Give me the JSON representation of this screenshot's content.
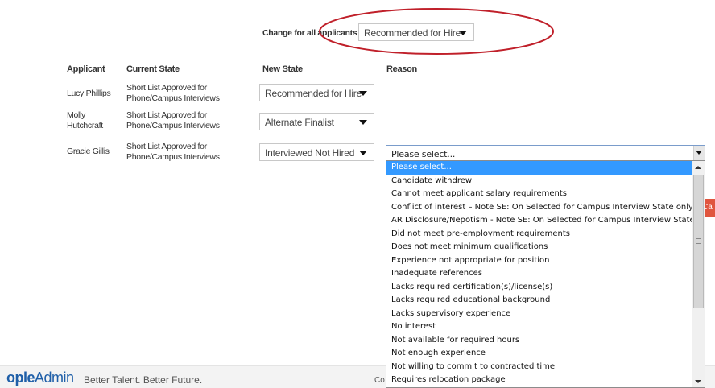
{
  "change_all": {
    "label": "Change for all applicants",
    "value": "Recommended for Hire"
  },
  "table": {
    "headers": [
      "Applicant",
      "Current State",
      "New State",
      "Reason"
    ],
    "rows": [
      {
        "applicant": [
          "Lucy Phillips"
        ],
        "current_state": [
          "Short List Approved for",
          "Phone/Campus Interviews"
        ],
        "new_state": "Recommended for Hire"
      },
      {
        "applicant": [
          "Molly",
          "Hutchcraft"
        ],
        "current_state": [
          "Short List Approved for",
          "Phone/Campus Interviews"
        ],
        "new_state": "Alternate Finalist"
      },
      {
        "applicant": [
          "Gracie Gillis"
        ],
        "current_state": [
          "Short List Approved for",
          "Phone/Campus Interviews"
        ],
        "new_state": "Interviewed Not Hired"
      }
    ]
  },
  "reason": {
    "value": "Please select...",
    "options": [
      "Please select...",
      "Candidate withdrew",
      "Cannot meet applicant salary requirements",
      "Conflict of interest – Note SE: On Selected for Campus Interview State only",
      "AR Disclosure/Nepotism - Note SE: On Selected for Campus Interview State only",
      "Did not meet pre-employment requirements",
      "Does not meet minimum qualifications",
      "Experience not appropriate for position",
      "Inadequate references",
      "Lacks required certification(s)/license(s)",
      "Lacks required educational background",
      "Lacks supervisory experience",
      "No interest",
      "Not available for required hours",
      "Not enough experience",
      "Not willing to commit to contracted time",
      "Requires relocation package"
    ],
    "selected_index": 0
  },
  "side_button": {
    "label": "Ca"
  },
  "footer": {
    "logo_prefix": "ople",
    "logo_main": "Admin",
    "tagline": "Better Talent. Better Future.",
    "partial_text": "Co"
  },
  "colors": {
    "highlight": "#3399ff",
    "annotation_circle": "#c0202a",
    "logo_blue": "#1f5fa8",
    "side_button": "#e0553e"
  }
}
